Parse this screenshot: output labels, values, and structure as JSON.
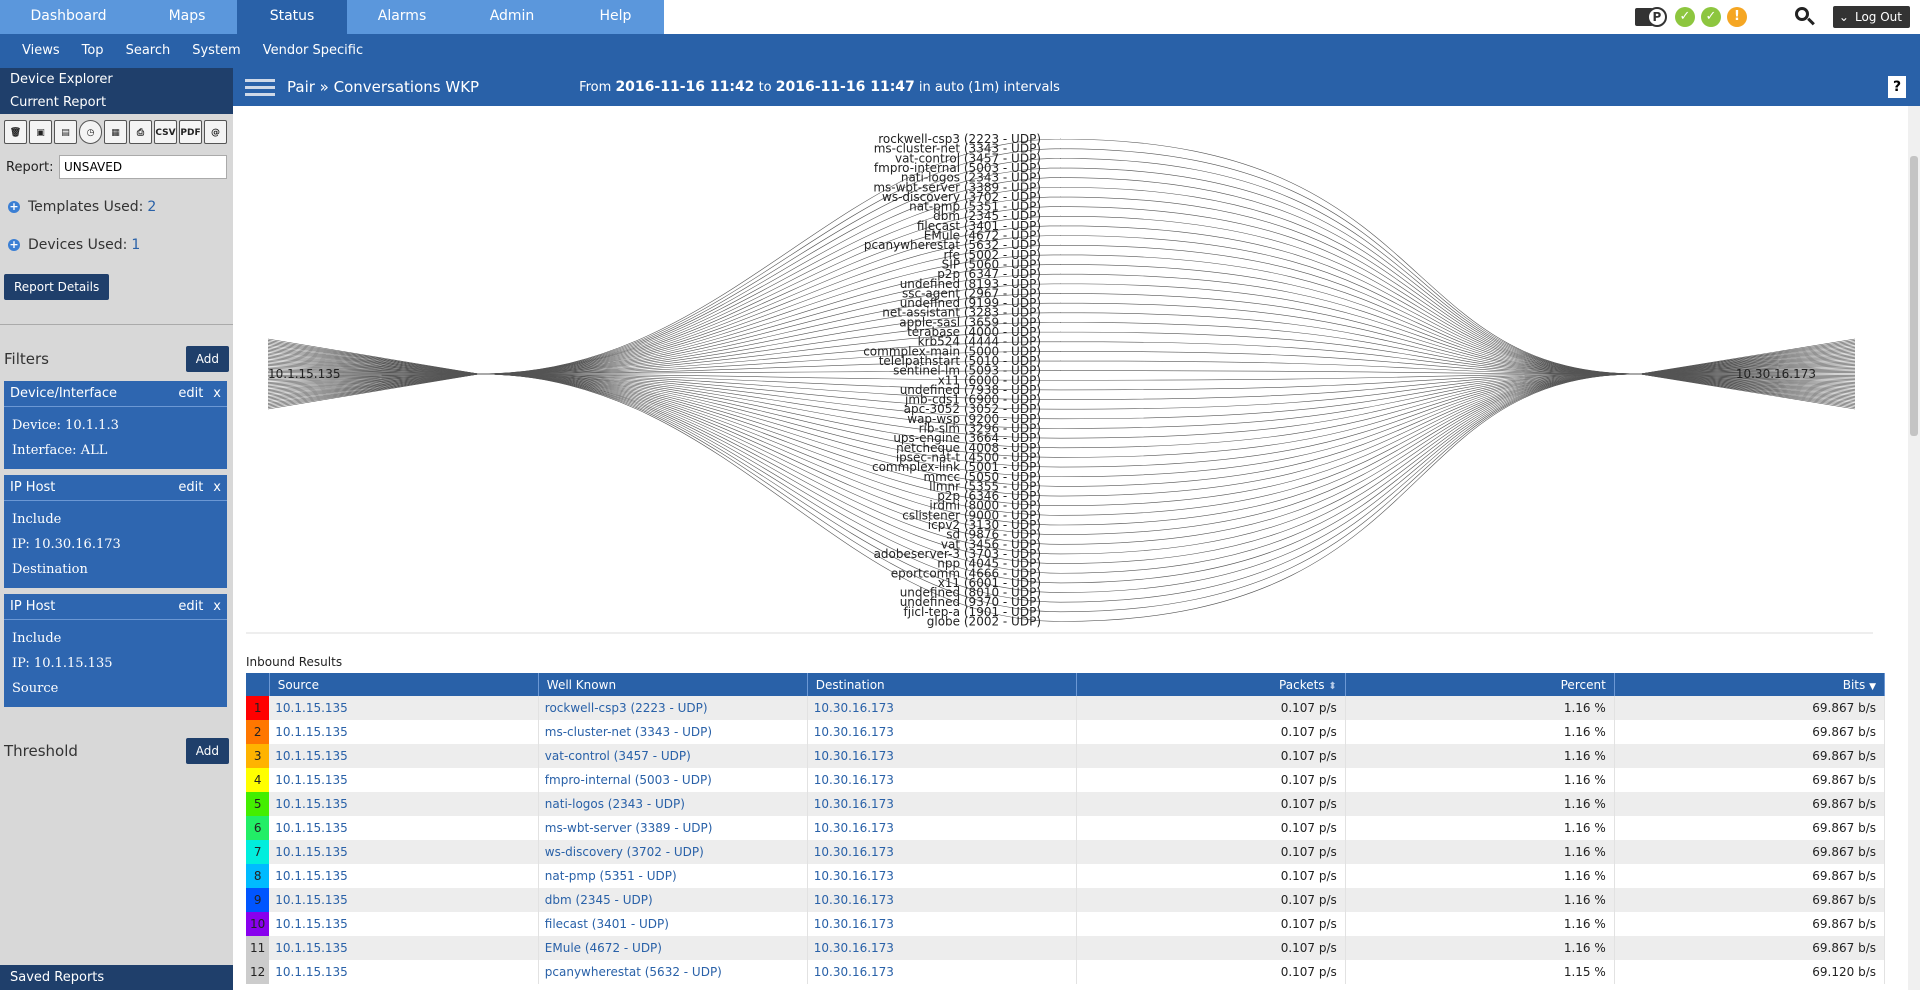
{
  "nav": {
    "tabs": [
      "Dashboard",
      "Maps",
      "Status",
      "Alarms",
      "Admin",
      "Help"
    ],
    "active_tab": "Status",
    "subnav": [
      "Views",
      "Top",
      "Search",
      "System",
      "Vendor Specific"
    ],
    "logout_label": "Log Out",
    "pbadge": "P"
  },
  "sidebar": {
    "device_explorer": "Device Explorer",
    "current_report": "Current Report",
    "toolbar_labels": {
      "csv": "CSV",
      "pdf": "PDF",
      "at": "@"
    },
    "report_label": "Report:",
    "report_value": "UNSAVED",
    "templates_label": "Templates Used:",
    "templates_count": "2",
    "devices_label": "Devices Used:",
    "devices_count": "1",
    "report_details": "Report Details",
    "filters_label": "Filters",
    "add_label": "Add",
    "edit_label": "edit",
    "close_label": "x",
    "filters": [
      {
        "title": "Device/Interface",
        "lines": [
          "Device: 10.1.1.3",
          "Interface: ALL"
        ]
      },
      {
        "title": "IP Host",
        "lines": [
          "Include",
          "IP: 10.30.16.173",
          "Destination"
        ]
      },
      {
        "title": "IP Host",
        "lines": [
          "Include",
          "IP: 10.1.15.135",
          "Source"
        ]
      }
    ],
    "threshold_label": "Threshold",
    "saved_reports": "Saved Reports"
  },
  "main": {
    "title": "Pair » Conversations WKP",
    "range_from_label": "From",
    "range_from": "2016-11-16 11:42",
    "range_to_label": "to",
    "range_to": "2016-11-16 11:47",
    "range_suffix": "in auto (1m) intervals",
    "help": "?"
  },
  "diagram": {
    "source": "10.1.15.135",
    "destination": "10.30.16.173",
    "labels": [
      "rockwell-csp3 (2223 - UDP)",
      "ms-cluster-net (3343 - UDP)",
      "vat-control (3457 - UDP)",
      "fmpro-internal (5003 - UDP)",
      "nati-logos (2343 - UDP)",
      "ms-wbt-server (3389 - UDP)",
      "ws-discovery (3702 - UDP)",
      "nat-pmp (5351 - UDP)",
      "dbm (2345 - UDP)",
      "filecast (3401 - UDP)",
      "EMule (4672 - UDP)",
      "pcanywherestat (5632 - UDP)",
      "rfe (5002 - UDP)",
      "SIP (5060 - UDP)",
      "p2p (6347 - UDP)",
      "undefined (8193 - UDP)",
      "ssc-agent (2967 - UDP)",
      "undefined (9199 - UDP)",
      "net-assistant (3283 - UDP)",
      "apple-sasl (3659 - UDP)",
      "terabase (4000 - UDP)",
      "krb524 (4444 - UDP)",
      "commplex-main (5000 - UDP)",
      "telelpathstart (5010 - UDP)",
      "sentinel-lm (5093 - UDP)",
      "x11 (6000 - UDP)",
      "undefined (7938 - UDP)",
      "jmb-cds1 (6900 - UDP)",
      "apc-3052 (3052 - UDP)",
      "wap-wsp (9200 - UDP)",
      "rib-slm (3296 - UDP)",
      "ups-engine (3664 - UDP)",
      "netcheque (4008 - UDP)",
      "ipsec-nat-t (4500 - UDP)",
      "commplex-link (5001 - UDP)",
      "mmcc (5050 - UDP)",
      "llmnr (5355 - UDP)",
      "p2p (6346 - UDP)",
      "irdmi (8000 - UDP)",
      "cslistener (9000 - UDP)",
      "icpv2 (3130 - UDP)",
      "sd (9876 - UDP)",
      "vat (3456 - UDP)",
      "adobeserver-3 (3703 - UDP)",
      "npp (4045 - UDP)",
      "eportcomm (4666 - UDP)",
      "x11 (6001 - UDP)",
      "undefined (8010 - UDP)",
      "undefined (9370 - UDP)",
      "fjicl-tep-a (1901 - UDP)",
      "globe (2002 - UDP)"
    ]
  },
  "results": {
    "caption": "Inbound Results",
    "columns": [
      "Source",
      "Well Known",
      "Destination",
      "Packets",
      "Percent",
      "Bits"
    ],
    "sort_indicators": {
      "packets": "⬍",
      "bits": "▼"
    },
    "rows": [
      {
        "i": "1",
        "color": "#ff0000",
        "src": "10.1.15.135",
        "wk": "rockwell-csp3 (2223 - UDP)",
        "dst": "10.30.16.173",
        "packets": "0.107 p/s",
        "percent": "1.16 %",
        "bits": "69.867 b/s"
      },
      {
        "i": "2",
        "color": "#ff7700",
        "src": "10.1.15.135",
        "wk": "ms-cluster-net (3343 - UDP)",
        "dst": "10.30.16.173",
        "packets": "0.107 p/s",
        "percent": "1.16 %",
        "bits": "69.867 b/s"
      },
      {
        "i": "3",
        "color": "#ffb300",
        "src": "10.1.15.135",
        "wk": "vat-control (3457 - UDP)",
        "dst": "10.30.16.173",
        "packets": "0.107 p/s",
        "percent": "1.16 %",
        "bits": "69.867 b/s"
      },
      {
        "i": "4",
        "color": "#ffff00",
        "src": "10.1.15.135",
        "wk": "fmpro-internal (5003 - UDP)",
        "dst": "10.30.16.173",
        "packets": "0.107 p/s",
        "percent": "1.16 %",
        "bits": "69.867 b/s"
      },
      {
        "i": "5",
        "color": "#44ee00",
        "src": "10.1.15.135",
        "wk": "nati-logos (2343 - UDP)",
        "dst": "10.30.16.173",
        "packets": "0.107 p/s",
        "percent": "1.16 %",
        "bits": "69.867 b/s"
      },
      {
        "i": "6",
        "color": "#22ee66",
        "src": "10.1.15.135",
        "wk": "ms-wbt-server (3389 - UDP)",
        "dst": "10.30.16.173",
        "packets": "0.107 p/s",
        "percent": "1.16 %",
        "bits": "69.867 b/s"
      },
      {
        "i": "7",
        "color": "#00eedd",
        "src": "10.1.15.135",
        "wk": "ws-discovery (3702 - UDP)",
        "dst": "10.30.16.173",
        "packets": "0.107 p/s",
        "percent": "1.16 %",
        "bits": "69.867 b/s"
      },
      {
        "i": "8",
        "color": "#00bbff",
        "src": "10.1.15.135",
        "wk": "nat-pmp (5351 - UDP)",
        "dst": "10.30.16.173",
        "packets": "0.107 p/s",
        "percent": "1.16 %",
        "bits": "69.867 b/s"
      },
      {
        "i": "9",
        "color": "#0055ff",
        "src": "10.1.15.135",
        "wk": "dbm (2345 - UDP)",
        "dst": "10.30.16.173",
        "packets": "0.107 p/s",
        "percent": "1.16 %",
        "bits": "69.867 b/s"
      },
      {
        "i": "10",
        "color": "#8800ee",
        "src": "10.1.15.135",
        "wk": "filecast (3401 - UDP)",
        "dst": "10.30.16.173",
        "packets": "0.107 p/s",
        "percent": "1.16 %",
        "bits": "69.867 b/s"
      },
      {
        "i": "11",
        "color": "#cccccc",
        "src": "10.1.15.135",
        "wk": "EMule (4672 - UDP)",
        "dst": "10.30.16.173",
        "packets": "0.107 p/s",
        "percent": "1.16 %",
        "bits": "69.867 b/s"
      },
      {
        "i": "12",
        "color": "#cccccc",
        "src": "10.1.15.135",
        "wk": "pcanywherestat (5632 - UDP)",
        "dst": "10.30.16.173",
        "packets": "0.107 p/s",
        "percent": "1.15 %",
        "bits": "69.120 b/s"
      }
    ]
  }
}
